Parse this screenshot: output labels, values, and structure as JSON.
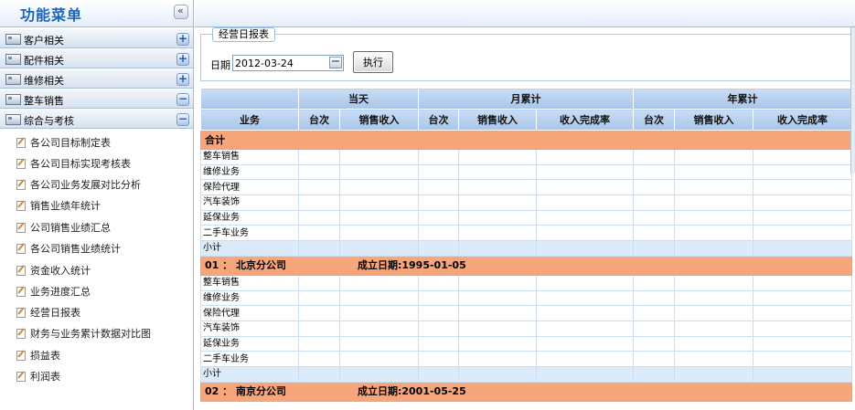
{
  "sidebar": {
    "title": "功能菜单",
    "groups": [
      {
        "label": "客户相关",
        "toggle": "+"
      },
      {
        "label": "配件相关",
        "toggle": "+"
      },
      {
        "label": "维修相关",
        "toggle": "+"
      },
      {
        "label": "整车销售",
        "toggle": "−"
      },
      {
        "label": "综合与考核",
        "toggle": "−"
      }
    ],
    "items": [
      "各公司目标制定表",
      "各公司目标实现考核表",
      "各公司业务发展对比分析",
      "销售业绩年统计",
      "公司销售业绩汇总",
      "各公司销售业绩统计",
      "资金收入统计",
      "业务进度汇总",
      "经营日报表",
      "财务与业务累计数据对比图",
      "损益表",
      "利润表"
    ]
  },
  "query": {
    "legend": "经营日报表",
    "date_label": "日期",
    "date_value": "2012-03-24",
    "run_label": "执行"
  },
  "table": {
    "group_headers": [
      "当天",
      "月累计",
      "年累计"
    ],
    "sub_headers": [
      "业务",
      "台次",
      "销售收入",
      "台次",
      "销售收入",
      "收入完成率",
      "台次",
      "销售收入",
      "收入完成率"
    ],
    "total_label": "合计",
    "business_rows": [
      "整车销售",
      "维修业务",
      "保险代理",
      "汽车装饰",
      "延保业务",
      "二手车业务"
    ],
    "subtotal_label": "小计",
    "companies": [
      {
        "code": "01 ： 北京分公司",
        "founded": "成立日期:1995-01-05"
      },
      {
        "code": "02 ： 南京分公司",
        "founded": "成立日期:2001-05-25"
      }
    ]
  }
}
